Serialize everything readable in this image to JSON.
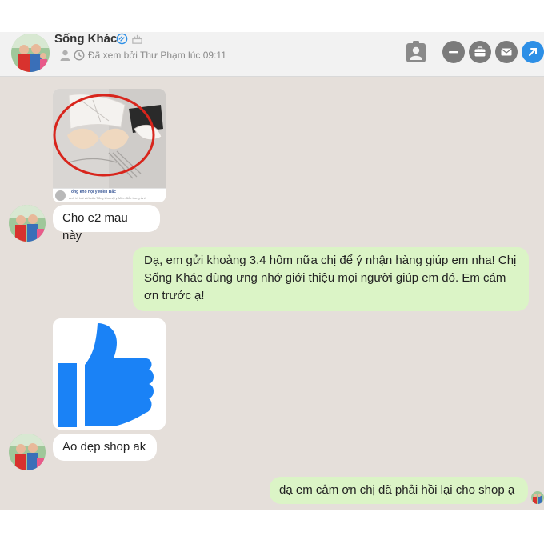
{
  "header": {
    "contact_name": "Sống Khác",
    "seen_status": "Đã xem bởi Thư Phạm lúc 09:11"
  },
  "messages": {
    "m1_text": "Cho e2 mau này",
    "m2_text": "Dạ, em gửi khoảng 3.4 hôm nữa chị để ý nhận hàng giúp em nha! Chị Sống Khác dùng ưng nhớ giới thiệu mọi người giúp em đó. Em cám ơn trước ạ!",
    "m3_text": "Ao dẹp shop ak",
    "m4_text": "dạ em cảm ơn chị đã phải hồi lại cho shop ạ"
  },
  "shared_image": {
    "caption_title": "Tổng kho nội y Miền Bắc",
    "caption_sub": "Ảnh từ bài viết của Tổng kho nội y Miền Bắc trong Ảnh"
  },
  "colors": {
    "chat_bg": "#e5dfda",
    "outgoing_bubble": "#dbf4c6",
    "incoming_bubble": "#ffffff",
    "like_blue": "#1a82f6",
    "action_blue": "#2d8fe6"
  },
  "icons": [
    "verified-icon",
    "cake-icon",
    "person-icon",
    "clock-icon",
    "contact-card-icon",
    "minimize-icon",
    "briefcase-icon",
    "mail-icon",
    "open-external-icon",
    "thumbs-up-icon"
  ]
}
